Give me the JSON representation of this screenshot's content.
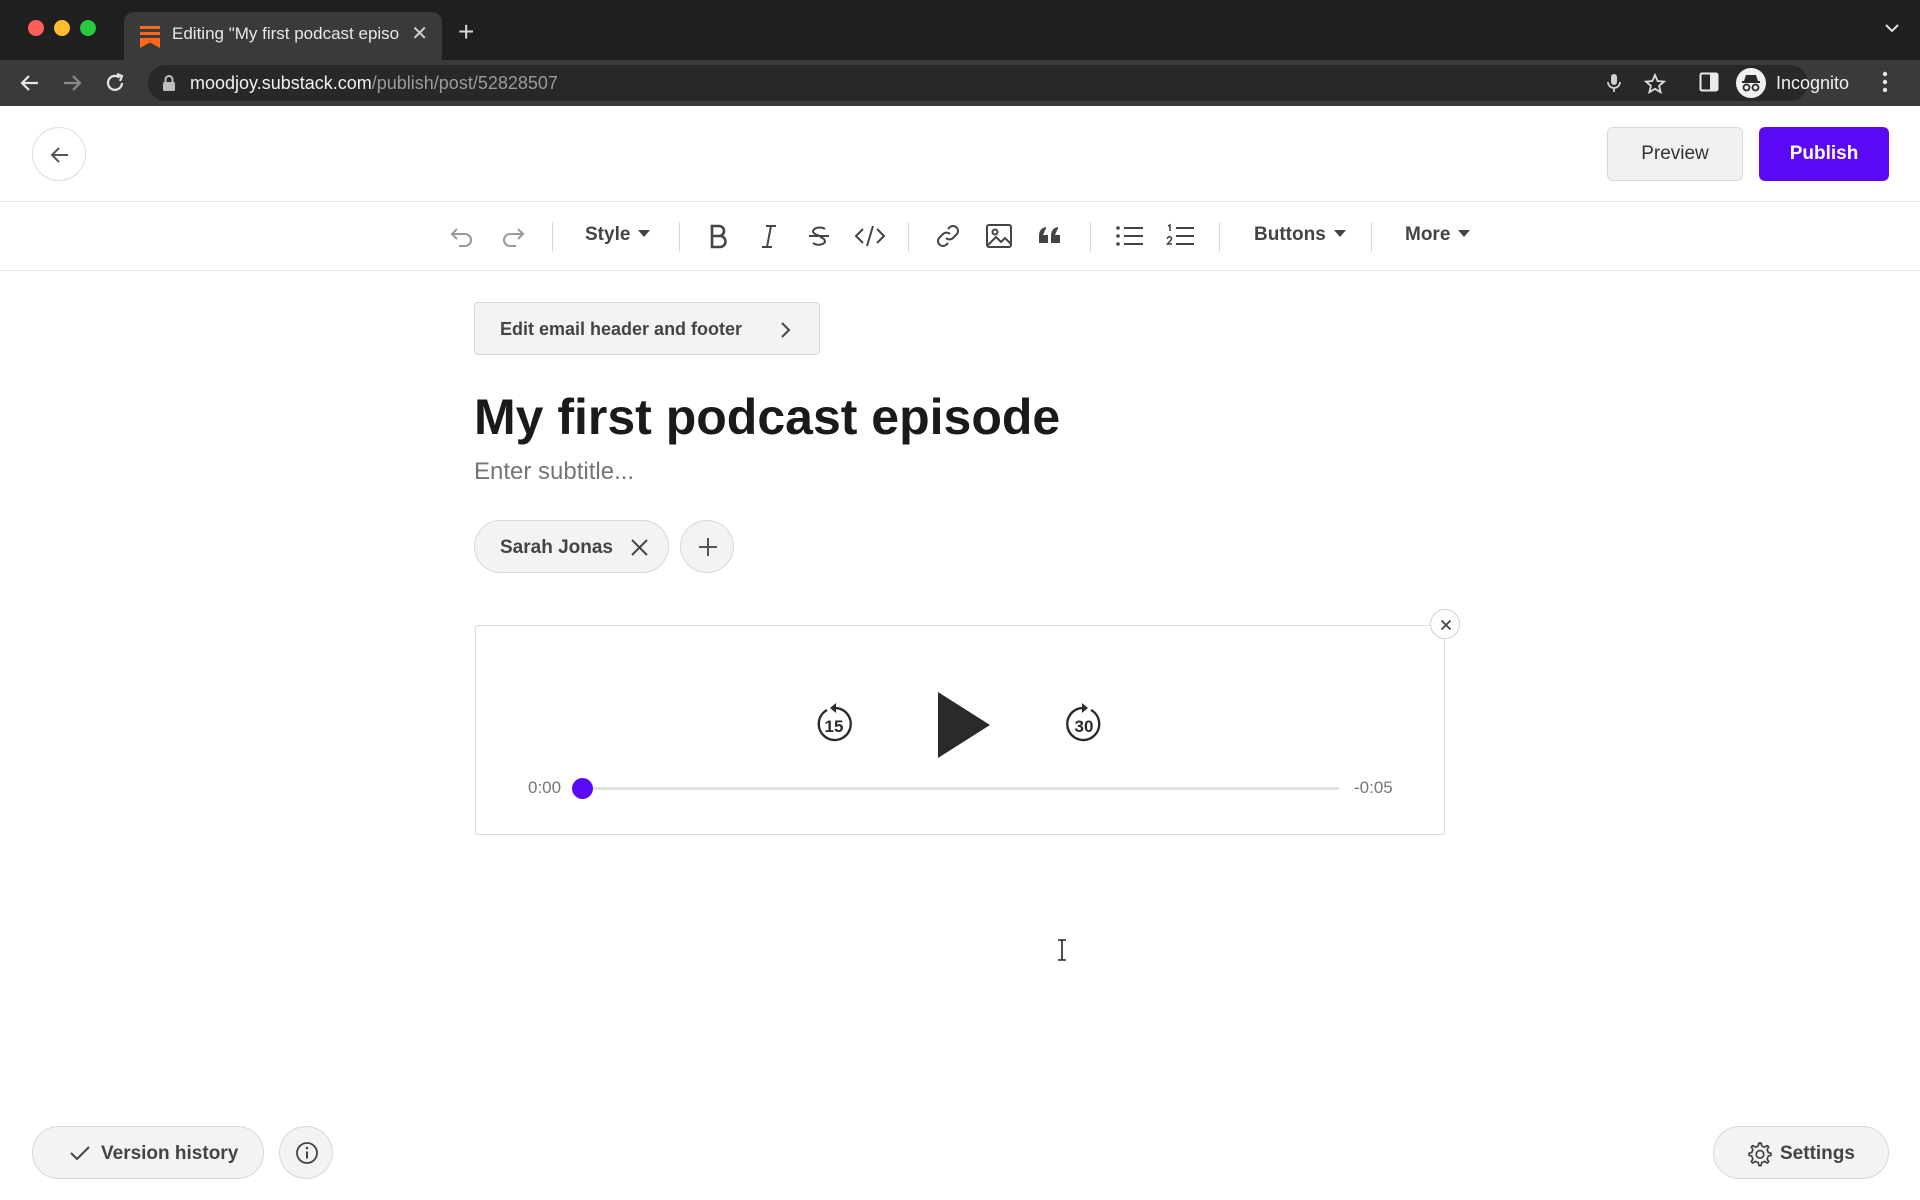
{
  "browser": {
    "tab_title": "Editing \"My first podcast episo",
    "url_host": "moodjoy.substack.com",
    "url_path": "/publish/post/52828507",
    "profile_label": "Incognito"
  },
  "header": {
    "preview_label": "Preview",
    "publish_label": "Publish"
  },
  "toolbar": {
    "style_label": "Style",
    "buttons_label": "Buttons",
    "more_label": "More"
  },
  "editor": {
    "email_header_label": "Edit email header and footer",
    "title": "My first podcast episode",
    "subtitle_placeholder": "Enter subtitle...",
    "author": "Sarah Jonas"
  },
  "player": {
    "current_time": "0:00",
    "remaining_time": "-0:05",
    "progress": 0,
    "skip_back_seconds": "15",
    "skip_forward_seconds": "30"
  },
  "footer": {
    "version_history_label": "Version history",
    "settings_label": "Settings"
  },
  "colors": {
    "accent": "#5b08f5",
    "favicon": "#ff6719"
  }
}
